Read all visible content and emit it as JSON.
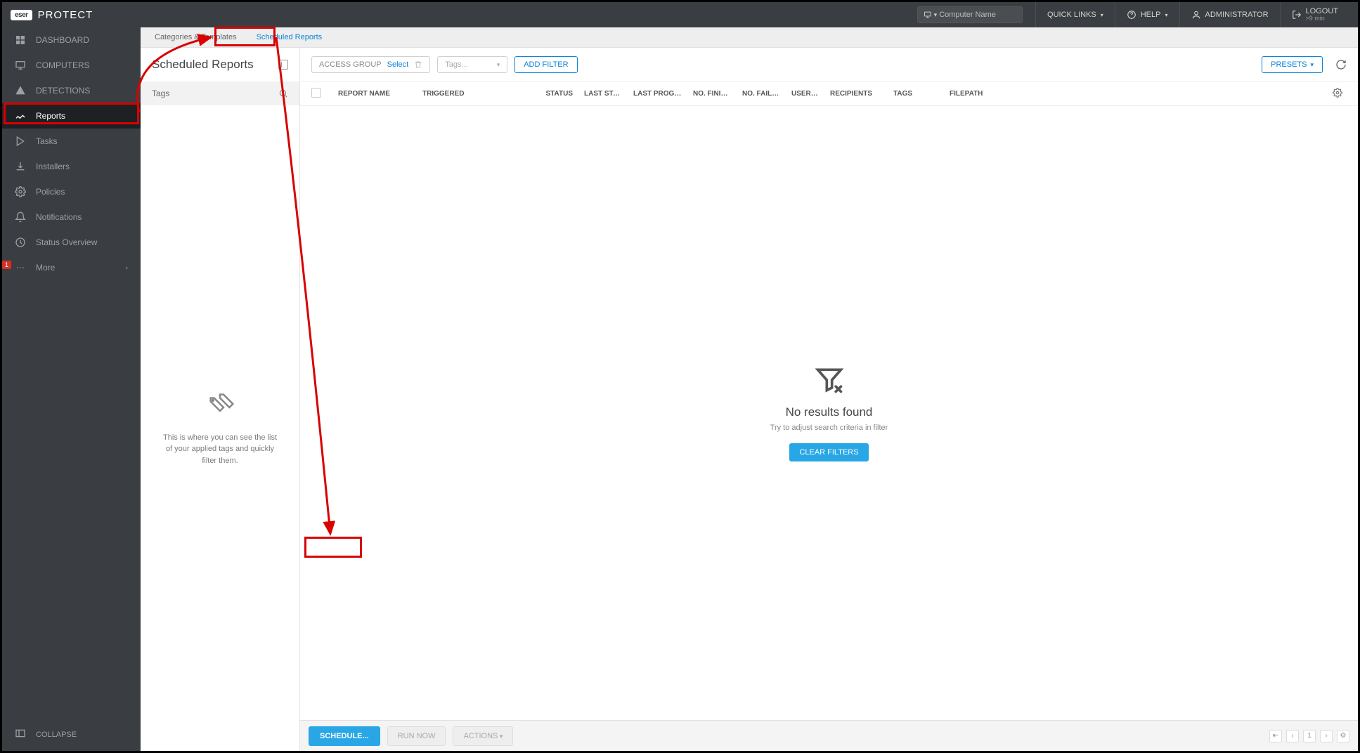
{
  "brand": {
    "logo": "eser",
    "name": "PROTECT"
  },
  "header": {
    "search_placeholder": "Computer Name",
    "quick_links": "QUICK LINKS",
    "help": "HELP",
    "admin": "ADMINISTRATOR",
    "logout": "LOGOUT",
    "logout_sub": ">9 min"
  },
  "sidebar": {
    "items": [
      {
        "label": "DASHBOARD"
      },
      {
        "label": "COMPUTERS"
      },
      {
        "label": "DETECTIONS"
      },
      {
        "label": "Reports"
      },
      {
        "label": "Tasks"
      },
      {
        "label": "Installers"
      },
      {
        "label": "Policies"
      },
      {
        "label": "Notifications"
      },
      {
        "label": "Status Overview"
      },
      {
        "label": "More"
      }
    ],
    "more_badge": "1",
    "collapse": "COLLAPSE"
  },
  "tabs": {
    "categories": "Categories & Templates",
    "scheduled": "Scheduled Reports"
  },
  "left_panel": {
    "title": "Scheduled Reports",
    "tags_label": "Tags",
    "empty_text": "This is where you can see the list of your applied tags and quickly filter them."
  },
  "filters": {
    "access_group": "ACCESS GROUP",
    "select": "Select",
    "tags_placeholder": "Tags...",
    "add_filter": "ADD FILTER",
    "presets": "PRESETS"
  },
  "columns": {
    "report": "REPORT NAME",
    "triggered": "TRIGGERED",
    "status": "STATUS",
    "last_status": "LAST STATUS",
    "last_progress": "LAST PROGRESS D",
    "no_finished": "NO. FINISHED",
    "no_failed": "NO. FAILED",
    "username": "USERNA",
    "recipients": "RECIPIENTS",
    "tags": "TAGS",
    "filepath": "FILEPATH"
  },
  "empty": {
    "title": "No results found",
    "sub": "Try to adjust search criteria in filter",
    "clear": "CLEAR FILTERS"
  },
  "footer": {
    "schedule": "SCHEDULE...",
    "run_now": "RUN NOW",
    "actions": "ACTIONS",
    "page": "1"
  }
}
